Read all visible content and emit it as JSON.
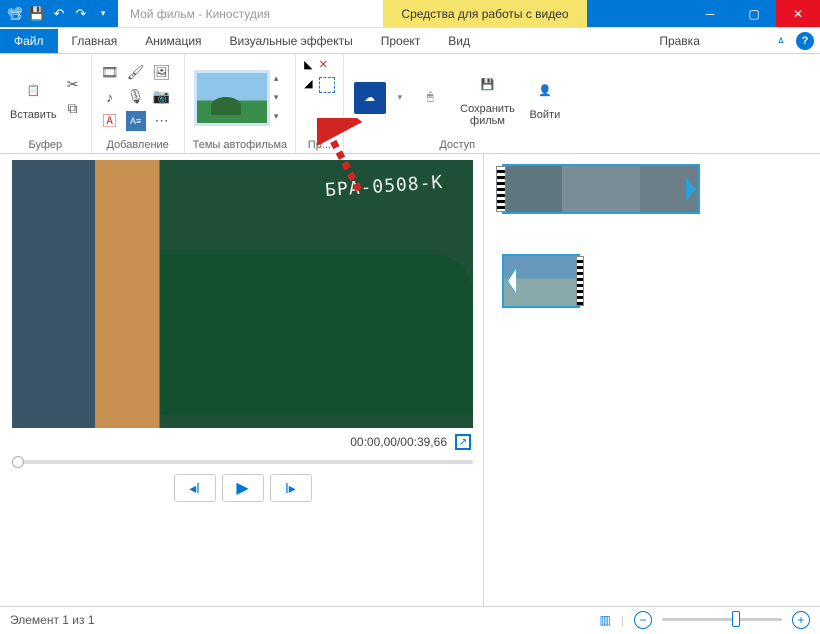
{
  "titlebar": {
    "title": "Мой фильм - Киностудия",
    "context_tab": "Средства для работы с видео"
  },
  "tabs": {
    "file": "Файл",
    "items": [
      "Главная",
      "Анимация",
      "Визуальные эффекты",
      "Проект",
      "Вид"
    ],
    "context_sub": "Правка"
  },
  "ribbon": {
    "buffer": {
      "paste": "Вставить",
      "label": "Буфер"
    },
    "adding": {
      "label": "Добавление"
    },
    "themes": {
      "label": "Темы автофильма"
    },
    "edit": {
      "label": "Пр..."
    },
    "access": {
      "save": "Сохранить\nфильм",
      "login": "Войти",
      "label": "Доступ"
    }
  },
  "preview": {
    "time": "00:00,00/00:39,66",
    "scene_text": "БРА-0508-К"
  },
  "status": {
    "items": "Элемент 1 из 1"
  }
}
